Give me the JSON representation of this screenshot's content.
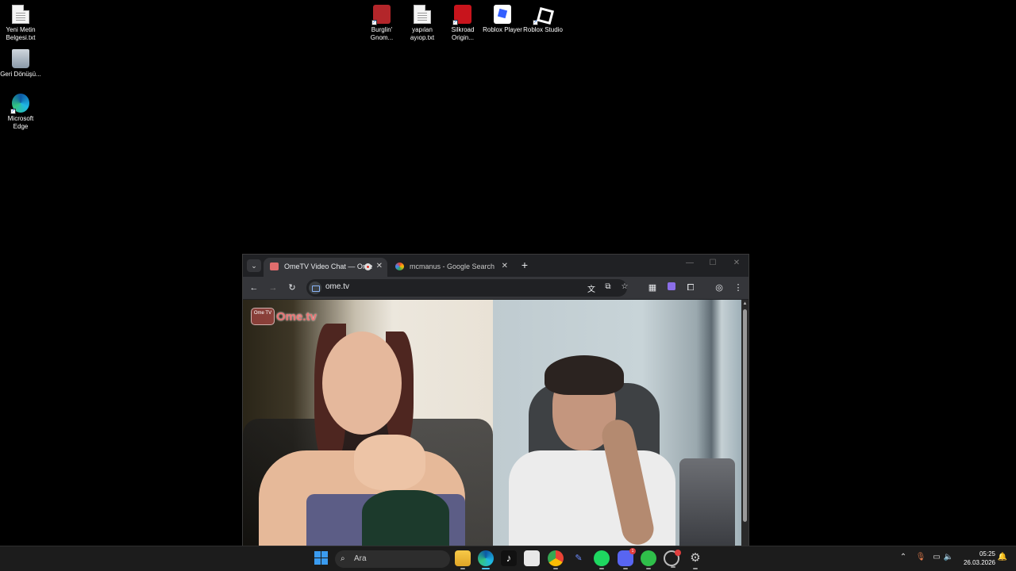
{
  "desktop": {
    "icons_left": [
      {
        "label": "Yeni Metin Belgesi.txt",
        "icon": "text-file-icon"
      },
      {
        "label": "Geri Dönüşü...",
        "icon": "recycle-bin-icon"
      },
      {
        "label": "Microsoft Edge",
        "icon": "edge-icon"
      }
    ],
    "icons_top": [
      {
        "label": "Burglin' Gnom...",
        "icon": "burglin-gnomes-icon"
      },
      {
        "label": "yapılan ayıop.txt",
        "icon": "text-file-icon"
      },
      {
        "label": "Silkroad Origin...",
        "icon": "silkroad-icon"
      },
      {
        "label": "Roblox Player",
        "icon": "roblox-player-icon"
      },
      {
        "label": "Roblox Studio",
        "icon": "roblox-studio-icon"
      }
    ]
  },
  "browser": {
    "tabs": [
      {
        "label": "OmeTV Video Chat — Ome",
        "favicon": "ometv-favicon",
        "recording": true,
        "active": true
      },
      {
        "label": "mcmanus - Google Search",
        "favicon": "google-favicon",
        "active": false
      }
    ],
    "new_tab_label": "+",
    "tab_list_label": "⌄",
    "window_controls": {
      "minimize": "—",
      "maximize": "☐",
      "close": "✕"
    },
    "url": "ome.tv",
    "page": {
      "logo_badge": "Ome TV",
      "logo_text": "Ome.tv"
    }
  },
  "taskbar": {
    "search_placeholder": "Ara",
    "apps": [
      "windows-start-icon",
      "file-explorer-icon",
      "edge-icon",
      "tiktok-icon",
      "microsoft-store-icon",
      "chrome-icon",
      "app-icon",
      "spotify-icon",
      "discord-icon",
      "green-app-icon",
      "settings-badge-icon",
      "settings-icon"
    ],
    "discord_badge": "1",
    "time": "05:25",
    "date": "26.03.2026"
  }
}
